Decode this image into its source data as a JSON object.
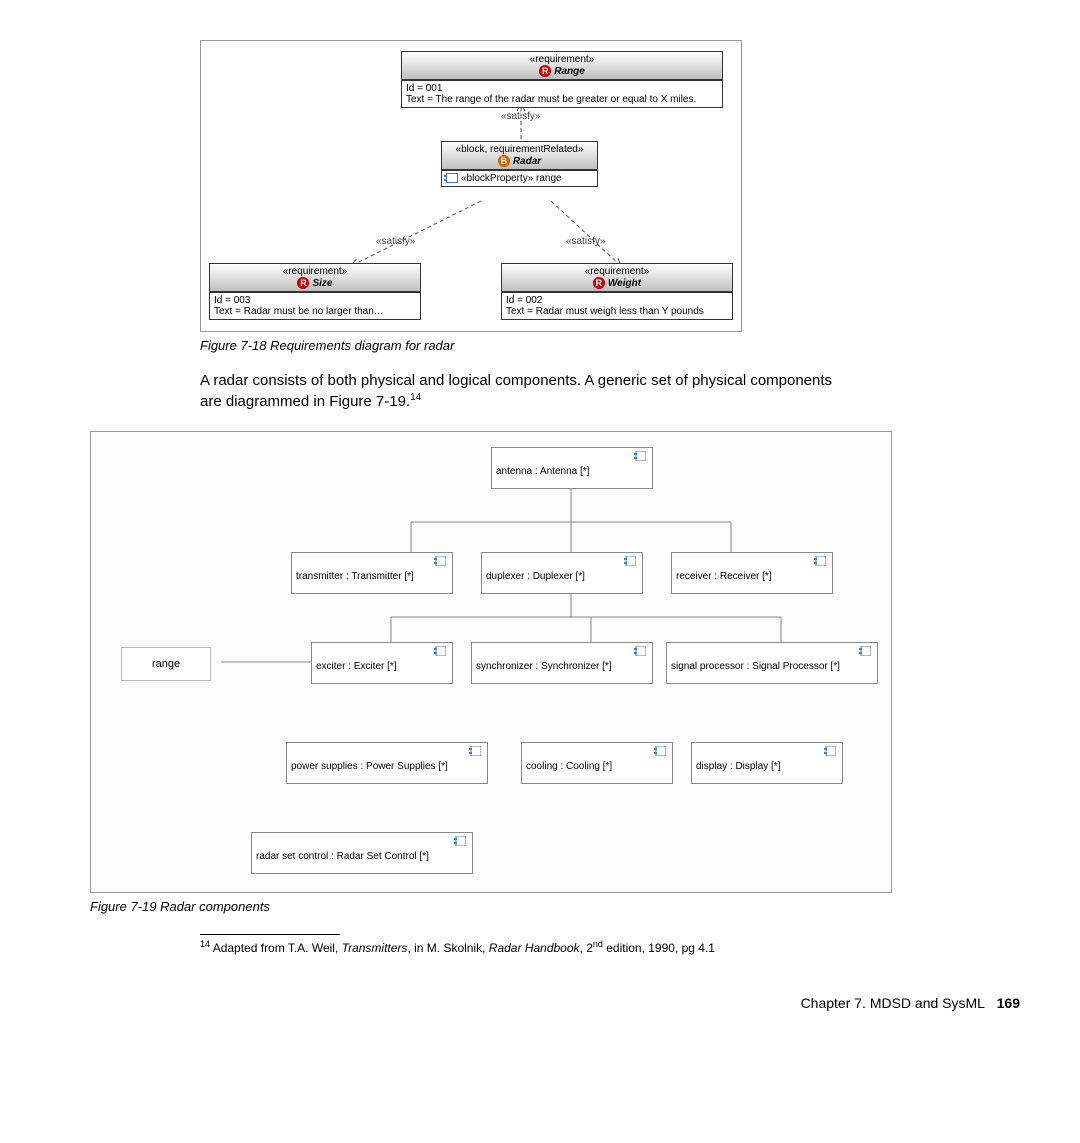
{
  "fig18": {
    "range": {
      "stereo": "«requirement»",
      "title": "Range",
      "id": "Id = 001",
      "text": "Text = The range of the radar must be greater or equal to X miles."
    },
    "radar": {
      "stereo": "«block, requirementRelated»",
      "title": "Radar",
      "prop": "«blockProperty» range"
    },
    "size": {
      "stereo": "«requirement»",
      "title": "Size",
      "id": "Id = 003",
      "text": "Text = Radar must be no larger than…"
    },
    "weight": {
      "stereo": "«requirement»",
      "title": "Weight",
      "id": "Id = 002",
      "text": "Text = Radar must weigh less than Y pounds"
    },
    "satisfy": "«satisfy»",
    "caption": "Figure 7-18   Requirements diagram for radar"
  },
  "body": {
    "p": "A radar consists of both physical and logical components. A generic set of physical components are diagrammed in Figure 7-19.",
    "fnref": "14"
  },
  "fig19": {
    "range": "range",
    "comps": {
      "antenna": "antenna : Antenna [*]",
      "transmitter": "transmitter : Transmitter [*]",
      "duplexer": "duplexer : Duplexer [*]",
      "receiver": "receiver : Receiver [*]",
      "exciter": "exciter : Exciter [*]",
      "synchronizer": "synchronizer : Synchronizer [*]",
      "signalproc": "signal processor : Signal Processor [*]",
      "power": "power supplies : Power Supplies [*]",
      "cooling": "cooling : Cooling [*]",
      "display": "display : Display [*]",
      "rsc": "radar set control : Radar Set Control [*]"
    },
    "caption": "Figure 7-19   Radar components"
  },
  "footnote": {
    "num": "14",
    "text_a": " Adapted from T.A. Weil, ",
    "text_b": "Transmitters",
    "text_c": ", in M. Skolnik, ",
    "text_d": "Radar Handbook",
    "text_e": ", 2",
    "text_f": "nd",
    "text_g": " edition, 1990, pg 4.1"
  },
  "footer": {
    "chapter": "Chapter 7. MDSD and SysML",
    "page": "169"
  }
}
